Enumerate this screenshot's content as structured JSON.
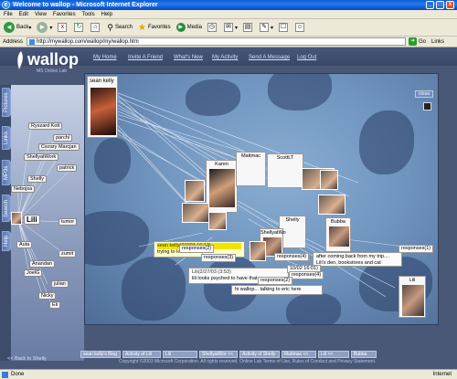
{
  "window": {
    "title": "Welcome to wallop - Microsoft Internet Explorer"
  },
  "menu": [
    "File",
    "Edit",
    "View",
    "Favorites",
    "Tools",
    "Help"
  ],
  "toolbar": {
    "back": "Back",
    "search": "Search",
    "favorites": "Favorites",
    "media": "Media"
  },
  "address": {
    "label": "Address",
    "url": "http://mywallop.com/wallop/my/wallop.htm",
    "go": "Go",
    "links": "Links"
  },
  "brand": {
    "name": "wallop",
    "sub": "MS Online Lab"
  },
  "nav": [
    "My Home",
    "Invite A Friend",
    "What's New",
    "My Activity",
    "Send A Message",
    "Log Out"
  ],
  "side_tabs": [
    "Pictures",
    "Links",
    "MP3s",
    "Search",
    "Help"
  ],
  "people": [
    "Ryszard Kott",
    "parchi",
    "Cezary Marcjan",
    "ShellyatWork",
    "patrick",
    "Shelly",
    "Nebojsa",
    "Lili",
    "tumor",
    "Auta",
    "zumit",
    "Anandan",
    "JoelG",
    "julian",
    "Nicky",
    "Eli"
  ],
  "back_link": "<< Back to Shelly",
  "canvas": {
    "close": "close",
    "main_person": "sean kelly",
    "cards": [
      "Karen",
      "Mattmac",
      "ScottLT",
      "Shelly",
      "ShellyatWo",
      "Bubba",
      "Lili"
    ],
    "messages": [
      {
        "header": "sean kelly(7/7/03 16:13)",
        "body": "trying to look thrilled, lol"
      },
      {
        "header": "Lili(2/27/03 (3:53)",
        "body": "lili looks psyched to have that camera...."
      },
      {
        "header": "",
        "body": "hi wallop... talking to eric here"
      },
      {
        "header": "",
        "body": "after coming back from my trip.... Lili's den, bookstores and cat slippers"
      }
    ],
    "responses": [
      "responses(1)",
      "responses(4)",
      "responses(4)",
      "responses(3)",
      "responses(2)",
      "responses(2)"
    ],
    "date_stub": "10/02 16:01)"
  },
  "bottom_tabs": [
    "sean kelly's Blog",
    "Activity of Lili",
    "Lili",
    "ShellyatWor <<",
    "Activity of Shelly",
    "Mattmac <<",
    "Lili <<",
    "Bubba"
  ],
  "footer": "Copyright ©2003 Microsoft Corporation. All rights reserved. Online Lab Terms of Use, Rules of Conduct and Privacy Statement.",
  "status": {
    "left": "Done",
    "zone": "Internet"
  }
}
